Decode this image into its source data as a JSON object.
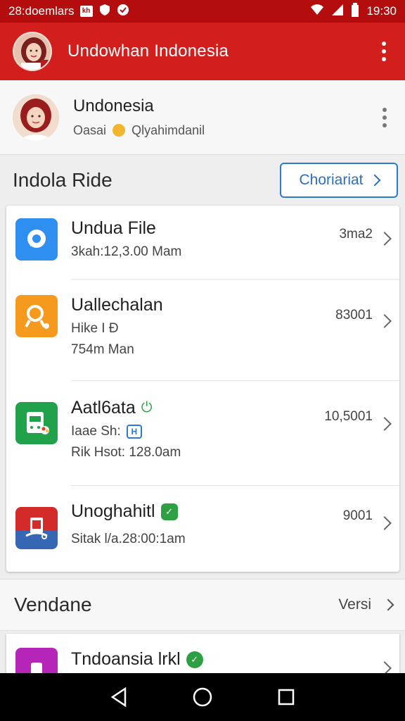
{
  "status_bar": {
    "left_text": "28:doemlars",
    "time": "19:30"
  },
  "app_bar": {
    "title": "Undowhan Indonesia"
  },
  "profile": {
    "name": "Undonesia",
    "sub_left": "Oasai",
    "sub_right": "Qlyahimdanil"
  },
  "section1": {
    "title": "Indola Ride",
    "button_label": "Choriariat"
  },
  "rows": [
    {
      "title": "Undua File",
      "line1": "3kah:12,3.00 Mam",
      "line2": "",
      "value": "3ma2",
      "icon": "chat-bubble-icon",
      "color": "#2e8ff0"
    },
    {
      "title": "Uallechalan",
      "line1": "Hike I Ð",
      "line2": "754m Man",
      "value": "83001",
      "icon": "search-icon",
      "color": "#f59a1c"
    },
    {
      "title": "Aatl6ata",
      "line1": "Iaae Sh:",
      "line2": "Rik Hsot: 128.0am",
      "value": "10,5001",
      "icon": "device-icon",
      "color": "#21a149"
    },
    {
      "title": "Unoghahitl",
      "line1": "Sitak l/a.28:00:1am",
      "line2": "",
      "value": "9001",
      "icon": "card-icon",
      "color": "#d32a2a"
    }
  ],
  "section2": {
    "title": "Vendane",
    "link_label": "Versi"
  },
  "partial_row": {
    "title": "Tndoansia lrkl",
    "color": "#b526b8"
  },
  "nav": {
    "back": "back-icon",
    "home": "home-icon",
    "recents": "recents-icon"
  }
}
